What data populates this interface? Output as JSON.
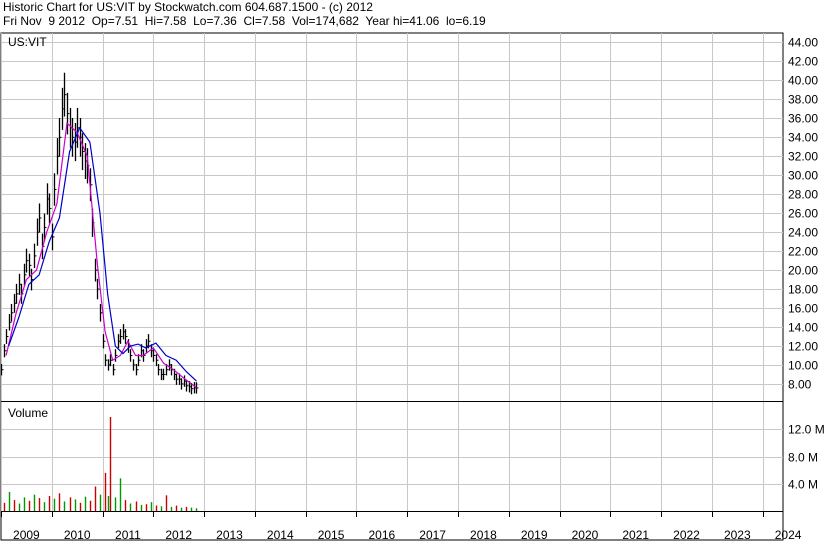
{
  "header": {
    "line1": "Historic Chart for US:VIT by Stockwatch.com 604.687.1500 - (c) 2012",
    "line2": "Fri Nov  9 2012  Op=7.51  Hi=7.58  Lo=7.36  Cl=7.58  Vol=174,682  Year hi=41.06  lo=6.19"
  },
  "chart_data": [
    {
      "type": "line",
      "panel": "price",
      "label": "US:VIT",
      "x_ticks": [
        "2009",
        "2010",
        "2011",
        "2012",
        "2013",
        "2014",
        "2015",
        "2016",
        "2017",
        "2018",
        "2019",
        "2020",
        "2021",
        "2022",
        "2023",
        "2024"
      ],
      "xlim": [
        2009,
        2024.4
      ],
      "ylim": [
        6.2,
        45.0
      ],
      "y_ticks": [
        "8.00",
        "10.00",
        "12.00",
        "14.00",
        "16.00",
        "18.00",
        "20.00",
        "22.00",
        "24.00",
        "26.00",
        "28.00",
        "30.00",
        "32.00",
        "34.00",
        "36.00",
        "38.00",
        "40.00",
        "42.00",
        "44.00"
      ],
      "grid": true,
      "series": [
        {
          "style": "price-bars",
          "color": "#000000",
          "x": [
            2009.0,
            2009.05,
            2009.1,
            2009.15,
            2009.2,
            2009.25,
            2009.3,
            2009.35,
            2009.4,
            2009.45,
            2009.5,
            2009.55,
            2009.6,
            2009.65,
            2009.7,
            2009.75,
            2009.8,
            2009.85,
            2009.9,
            2009.95,
            2010.0,
            2010.05,
            2010.1,
            2010.15,
            2010.2,
            2010.25,
            2010.3,
            2010.35,
            2010.4,
            2010.45,
            2010.5,
            2010.55,
            2010.6,
            2010.65,
            2010.7,
            2010.75,
            2010.8,
            2010.85,
            2010.9,
            2010.95,
            2011.0,
            2011.05,
            2011.1,
            2011.15,
            2011.2,
            2011.25,
            2011.3,
            2011.35,
            2011.4,
            2011.45,
            2011.5,
            2011.55,
            2011.6,
            2011.65,
            2011.7,
            2011.75,
            2011.8,
            2011.85,
            2011.9,
            2011.95,
            2012.0,
            2012.05,
            2012.1,
            2012.15,
            2012.2,
            2012.25,
            2012.3,
            2012.35,
            2012.4,
            2012.45,
            2012.5,
            2012.55,
            2012.6,
            2012.65,
            2012.7,
            2012.75,
            2012.8,
            2012.85
          ],
          "y": [
            9.5,
            11.5,
            13.0,
            14.5,
            15.5,
            16.5,
            17.5,
            18.5,
            17.5,
            19.5,
            21.0,
            20.5,
            19.0,
            21.5,
            24.0,
            25.5,
            22.5,
            24.5,
            27.5,
            26.5,
            23.5,
            28.5,
            32.0,
            34.0,
            37.0,
            38.5,
            36.5,
            35.0,
            34.0,
            33.5,
            35.0,
            34.0,
            32.5,
            31.5,
            31.0,
            29.0,
            25.0,
            20.0,
            18.0,
            15.5,
            12.5,
            10.5,
            10.0,
            10.5,
            9.5,
            11.0,
            12.5,
            13.0,
            13.5,
            13.0,
            12.0,
            11.0,
            10.0,
            9.5,
            10.5,
            11.5,
            11.0,
            12.0,
            12.5,
            11.5,
            11.0,
            10.5,
            9.5,
            9.0,
            9.0,
            9.5,
            10.0,
            9.5,
            9.0,
            8.5,
            8.5,
            8.0,
            8.3,
            7.8,
            7.7,
            7.5,
            7.6,
            7.58
          ]
        },
        {
          "style": "moving-average",
          "color": "#cc00cc",
          "x": [
            2009.1,
            2009.3,
            2009.5,
            2009.7,
            2009.9,
            2010.1,
            2010.3,
            2010.5,
            2010.7,
            2010.9,
            2011.05,
            2011.2,
            2011.35,
            2011.5,
            2011.65,
            2011.8,
            2012.0,
            2012.2,
            2012.4,
            2012.6,
            2012.8,
            2012.85
          ],
          "y": [
            11.0,
            15.5,
            19.0,
            20.0,
            24.0,
            27.0,
            35.5,
            34.5,
            32.0,
            20.5,
            13.5,
            10.5,
            11.0,
            12.5,
            11.0,
            11.0,
            11.8,
            10.2,
            9.5,
            8.6,
            7.8,
            7.6
          ]
        },
        {
          "style": "moving-average",
          "color": "#0000cc",
          "x": [
            2009.15,
            2009.35,
            2009.55,
            2009.75,
            2009.95,
            2010.15,
            2010.35,
            2010.55,
            2010.75,
            2010.95,
            2011.1,
            2011.25,
            2011.4,
            2011.55,
            2011.7,
            2011.85,
            2012.05,
            2012.25,
            2012.45,
            2012.65,
            2012.85
          ],
          "y": [
            12.0,
            15.0,
            18.5,
            19.5,
            23.0,
            25.5,
            32.5,
            35.0,
            33.5,
            26.0,
            17.5,
            12.0,
            11.2,
            12.0,
            12.2,
            11.8,
            12.3,
            11.0,
            10.5,
            9.3,
            8.3
          ]
        }
      ]
    },
    {
      "type": "bar",
      "panel": "volume",
      "label": "Volume",
      "ylim": [
        0,
        16.0
      ],
      "y_ticks": [
        "4.0 M",
        "8.0 M",
        "12.0 M"
      ],
      "grid": true,
      "series": [
        {
          "style": "volume-bars",
          "colors": {
            "up": "#009900",
            "down": "#cc0000",
            "neutral": "#000000"
          },
          "x": [
            2009.05,
            2009.15,
            2009.25,
            2009.35,
            2009.45,
            2009.55,
            2009.65,
            2009.75,
            2009.85,
            2009.95,
            2010.05,
            2010.15,
            2010.25,
            2010.35,
            2010.45,
            2010.55,
            2010.65,
            2010.75,
            2010.85,
            2010.95,
            2011.05,
            2011.1,
            2011.15,
            2011.25,
            2011.35,
            2011.45,
            2011.55,
            2011.65,
            2011.75,
            2011.85,
            2011.95,
            2012.05,
            2012.15,
            2012.25,
            2012.35,
            2012.45,
            2012.55,
            2012.65,
            2012.75,
            2012.85
          ],
          "values": [
            1.2,
            2.8,
            1.6,
            1.1,
            2.0,
            1.5,
            2.4,
            1.9,
            1.3,
            2.2,
            1.8,
            2.6,
            1.4,
            2.0,
            1.7,
            1.2,
            2.1,
            1.5,
            3.6,
            2.4,
            5.6,
            2.2,
            13.8,
            2.0,
            4.8,
            1.6,
            1.1,
            1.4,
            0.9,
            1.0,
            1.3,
            0.8,
            0.7,
            2.3,
            0.6,
            0.8,
            0.5,
            0.6,
            0.5,
            0.4
          ],
          "direction": [
            "down",
            "up",
            "down",
            "up",
            "up",
            "down",
            "up",
            "down",
            "up",
            "down",
            "up",
            "down",
            "up",
            "down",
            "up",
            "down",
            "up",
            "down",
            "down",
            "up",
            "down",
            "up",
            "down",
            "up",
            "up",
            "down",
            "up",
            "down",
            "up",
            "down",
            "up",
            "down",
            "up",
            "down",
            "up",
            "down",
            "up",
            "down",
            "up",
            "up"
          ]
        }
      ]
    }
  ]
}
